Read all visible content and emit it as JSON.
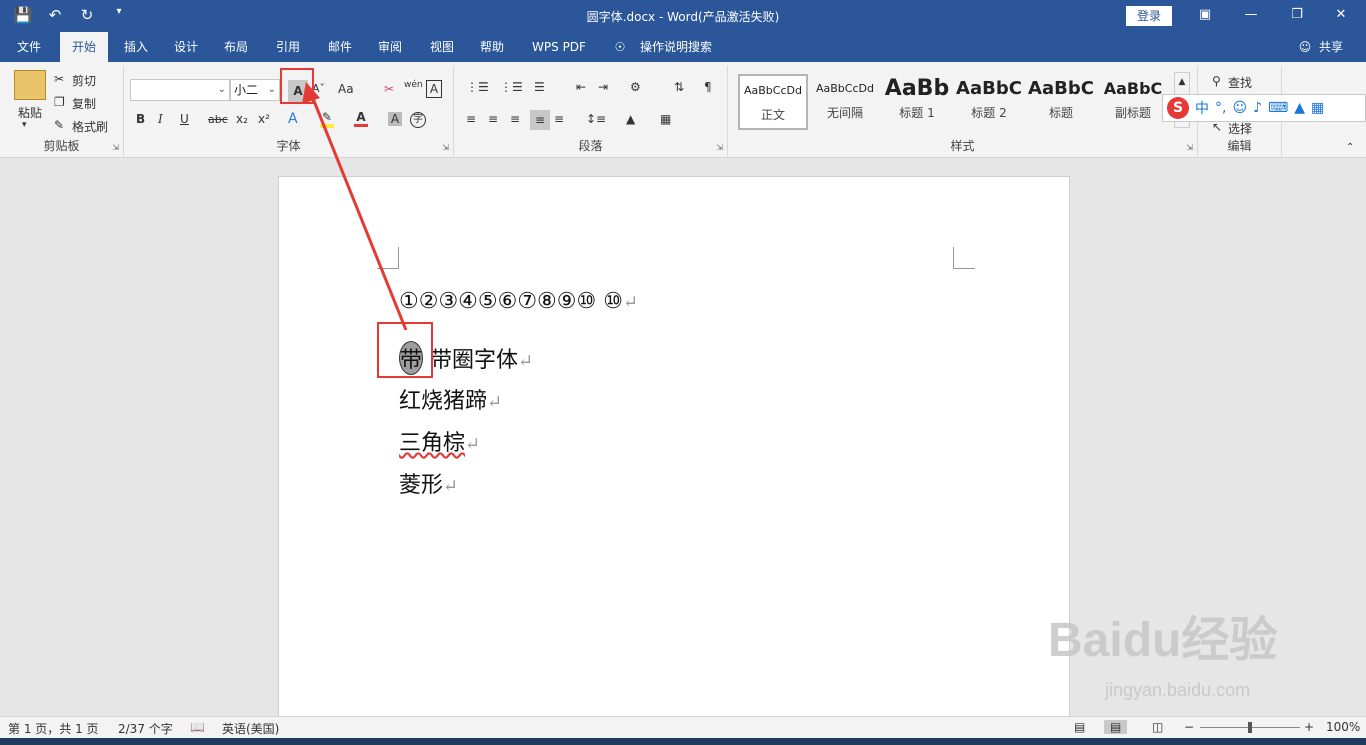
{
  "window": {
    "title": "圆字体.docx  -  Word(产品激活失败)",
    "login": "登录"
  },
  "qat_icons": [
    "save-icon",
    "undo-icon",
    "redo-icon",
    "customize-icon"
  ],
  "tabs": [
    "文件",
    "开始",
    "插入",
    "设计",
    "布局",
    "引用",
    "邮件",
    "审阅",
    "视图",
    "帮助",
    "WPS PDF",
    "操作说明搜索"
  ],
  "share": "共享",
  "clipboard": {
    "paste": "粘贴",
    "cut": "剪切",
    "copy": "复制",
    "format_painter": "格式刷",
    "label": "剪贴板"
  },
  "font": {
    "name": "",
    "size": "小二",
    "label": "字体",
    "grow": "A",
    "case": "Aa",
    "wen": "wén",
    "A_box": "A"
  },
  "paragraph": {
    "label": "段落"
  },
  "styles": {
    "label": "样式",
    "items": [
      {
        "preview": "AaBbCcDd",
        "name": "正文"
      },
      {
        "preview": "AaBbCcDd",
        "name": "无间隔"
      },
      {
        "preview": "AaBb",
        "name": "标题 1"
      },
      {
        "preview": "AaBbC",
        "name": "标题 2"
      },
      {
        "preview": "AaBbC",
        "name": "标题"
      },
      {
        "preview": "AaBbC",
        "name": "副标题"
      }
    ]
  },
  "editing": {
    "find": "查找",
    "select": "选择",
    "label": "编辑"
  },
  "ime": {
    "mode": "中",
    "punct": "°,"
  },
  "document": {
    "line1": "①②③④⑤⑥⑦⑧⑨⑩ ⑩",
    "line2_char": "带",
    "line2_text": " 带圈字体",
    "line3": "红烧猪蹄",
    "line4": "三角棕",
    "line5": "菱形",
    "para_mark": "↵"
  },
  "status": {
    "page": "第 1 页，共 1 页",
    "words": "2/37 个字",
    "lang": "英语(美国)",
    "zoom": "100%"
  },
  "watermark": {
    "brand": "Baidu经验",
    "url": "jingyan.baidu.com"
  },
  "accent_color": "#2b579a",
  "highlight_color": "#e53935"
}
